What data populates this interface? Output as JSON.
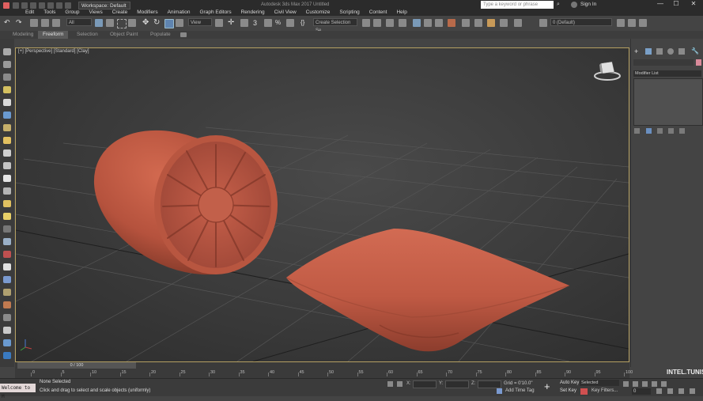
{
  "title_bar": {
    "workspace": "Workspace: Default",
    "app_title": "Autodesk 3ds Max 2017     Untitled",
    "search_placeholder": "Type a keyword or phrase",
    "sign_in": "Sign In",
    "window_buttons": [
      "—",
      "☐",
      "✕"
    ]
  },
  "menu": [
    "Edit",
    "Tools",
    "Group",
    "Views",
    "Create",
    "Modifiers",
    "Animation",
    "Graph Editors",
    "Rendering",
    "Civil View",
    "Customize",
    "Scripting",
    "Content",
    "Help"
  ],
  "toolbar": {
    "filter": "All",
    "reference_coord": "View",
    "selection_set": "Create Selection Se",
    "layer": "0 (Default)"
  },
  "ribbon_tabs": [
    "Modeling",
    "Freeform",
    "Selection",
    "Object Paint",
    "Populate"
  ],
  "ribbon_active": "Freeform",
  "viewport": {
    "label": "[+] [Perspective] [Standard] [Clay]"
  },
  "command_panel": {
    "modifier_list": "Modifier List"
  },
  "timeline": {
    "frame_slider": "0 / 100",
    "ticks": [
      "0",
      "5",
      "10",
      "15",
      "20",
      "25",
      "30",
      "35",
      "40",
      "45",
      "50",
      "55",
      "60",
      "65",
      "70",
      "75",
      "80",
      "85",
      "90",
      "95",
      "100"
    ]
  },
  "status": {
    "maxscript": "Welcome to M",
    "selection_status": "None Selected",
    "prompt": "Click and drag to select and scale objects (uniformly)",
    "coord_labels": [
      "X:",
      "Y:",
      "Z:"
    ],
    "grid": "Grid = 0'10.0\"",
    "add_time_tag": "Add Time Tag",
    "auto_key": "Auto Key",
    "set_key": "Set Key",
    "selected": "Selected",
    "key_filters": "Key Filters...",
    "frame": "0"
  },
  "watermark": "INTEL.TUNISIA"
}
